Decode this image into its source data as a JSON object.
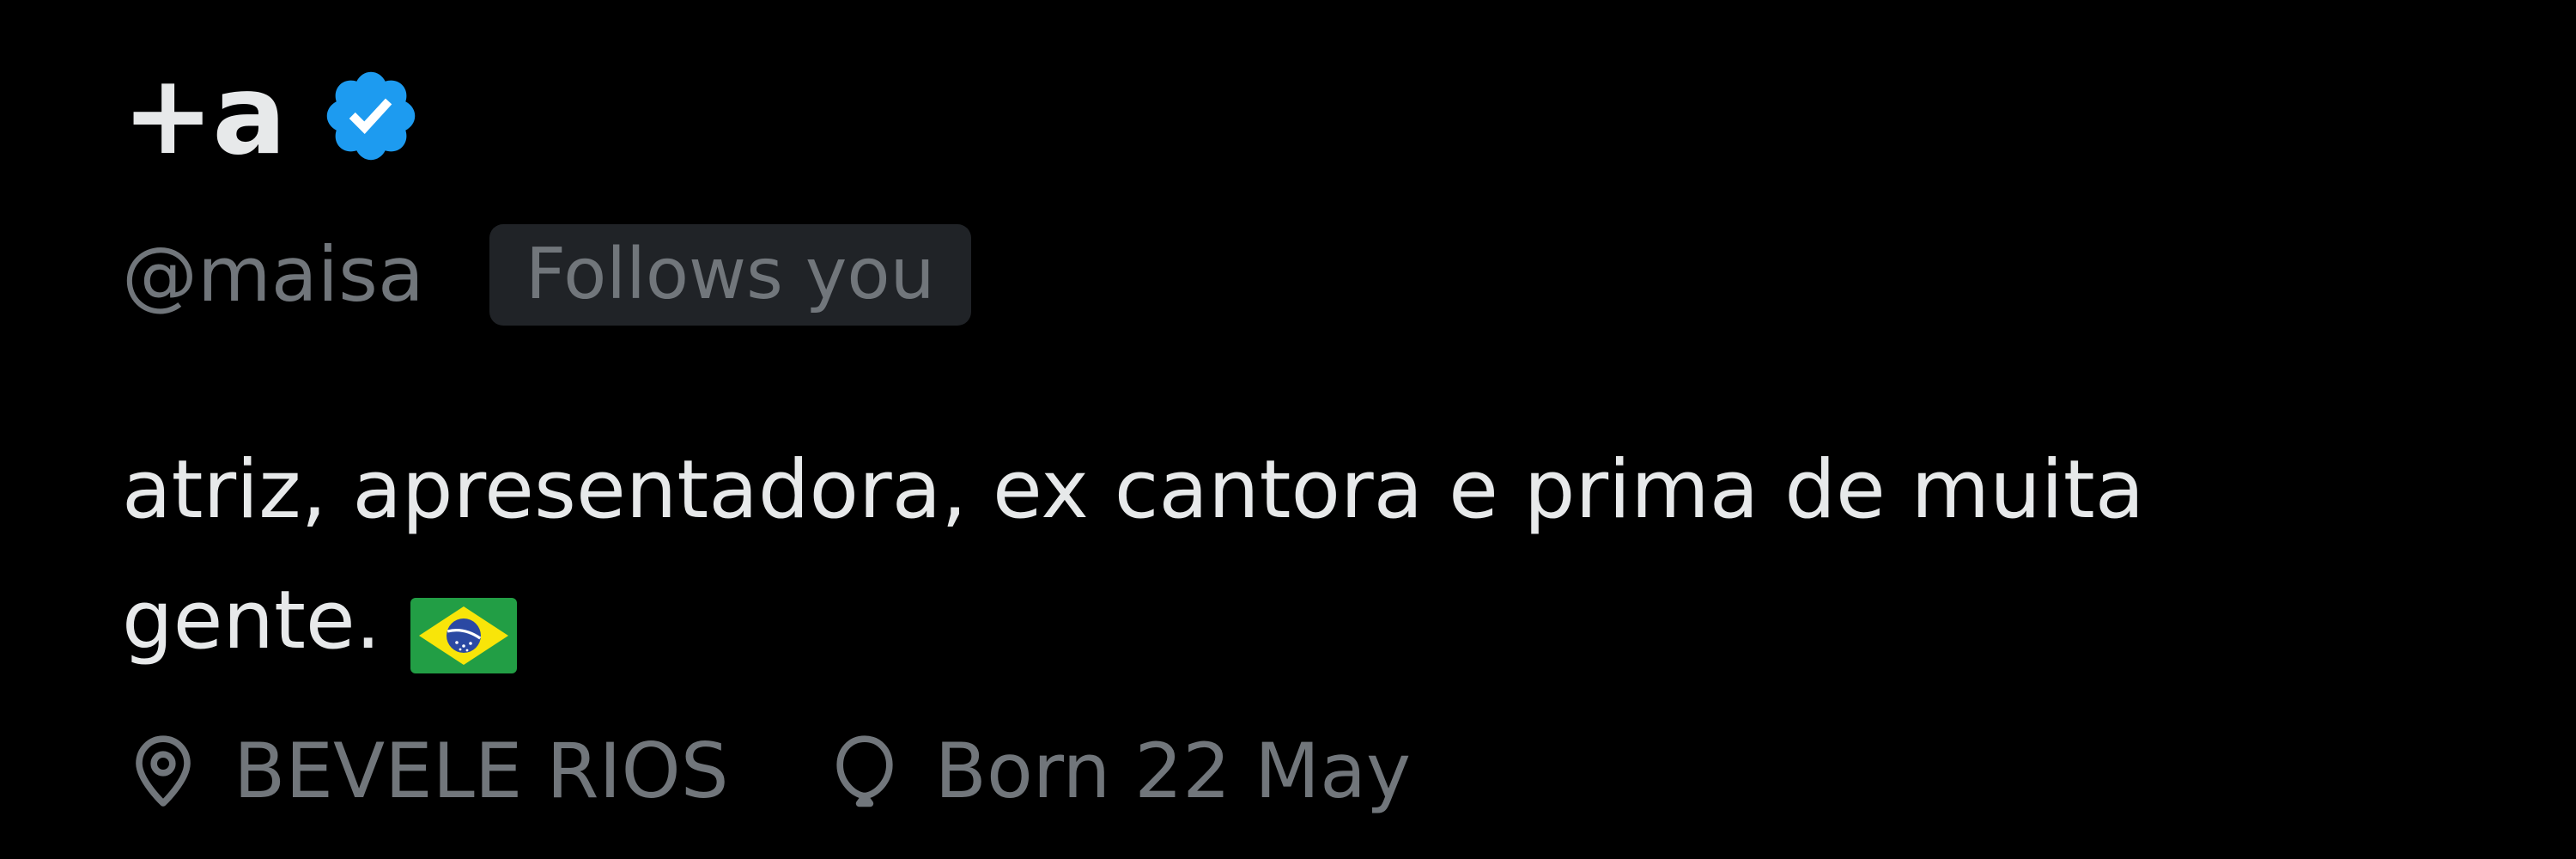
{
  "profile": {
    "display_name": "+a",
    "verified": true,
    "handle": "@maisa",
    "follows_you_label": "Follows you",
    "bio_line_1": "atriz, apresentadora, ex cantora e prima de muita",
    "bio_line_2": "gente.",
    "bio_emoji": "brazil-flag",
    "location": "BEVELE RIOS",
    "birthday": "Born 22 May"
  },
  "colors": {
    "background": "#000000",
    "primary_text": "#e7e9ea",
    "secondary_text": "#71767b",
    "badge_background": "#202327",
    "verified_blue": "#1d9bf0"
  },
  "icons": {
    "verified": "verified-badge-icon",
    "location": "location-pin-icon",
    "birthday": "balloon-icon"
  }
}
